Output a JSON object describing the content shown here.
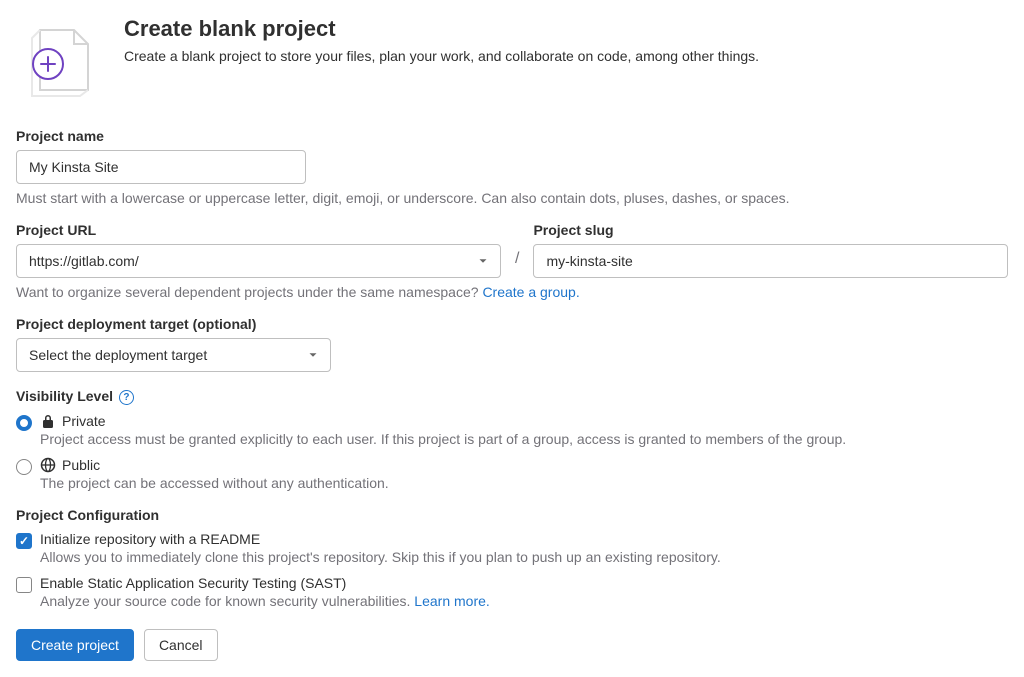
{
  "header": {
    "title": "Create blank project",
    "subtitle": "Create a blank project to store your files, plan your work, and collaborate on code, among other things."
  },
  "project_name": {
    "label": "Project name",
    "value": "My Kinsta Site",
    "helper": "Must start with a lowercase or uppercase letter, digit, emoji, or underscore. Can also contain dots, pluses, dashes, or spaces."
  },
  "project_url": {
    "label": "Project URL",
    "value": "https://gitlab.com/"
  },
  "slash": "/",
  "project_slug": {
    "label": "Project slug",
    "value": "my-kinsta-site"
  },
  "group_hint": {
    "text": "Want to organize several dependent projects under the same namespace? ",
    "link": "Create a group."
  },
  "deploy": {
    "label": "Project deployment target (optional)",
    "placeholder": "Select the deployment target"
  },
  "visibility": {
    "label": "Visibility Level",
    "private": {
      "name": "Private",
      "desc": "Project access must be granted explicitly to each user. If this project is part of a group, access is granted to members of the group."
    },
    "public": {
      "name": "Public",
      "desc": "The project can be accessed without any authentication."
    }
  },
  "config": {
    "label": "Project Configuration",
    "readme": {
      "name": "Initialize repository with a README",
      "desc": "Allows you to immediately clone this project's repository. Skip this if you plan to push up an existing repository."
    },
    "sast": {
      "name": "Enable Static Application Security Testing (SAST)",
      "desc": "Analyze your source code for known security vulnerabilities. ",
      "link": "Learn more."
    }
  },
  "buttons": {
    "create": "Create project",
    "cancel": "Cancel"
  }
}
